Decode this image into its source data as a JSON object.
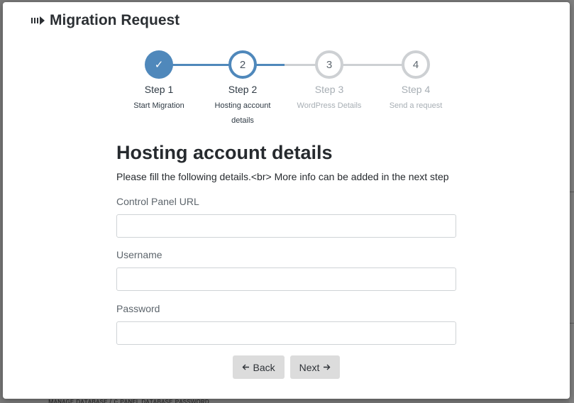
{
  "modal": {
    "title": "Migration Request"
  },
  "stepper": {
    "steps": [
      {
        "label": "Step 1",
        "sub": "Start Migration",
        "marker": "✓",
        "state": "done"
      },
      {
        "label": "Step 2",
        "sub": "Hosting account details",
        "marker": "2",
        "state": "active"
      },
      {
        "label": "Step 3",
        "sub": "WordPress Details",
        "marker": "3",
        "state": "pending"
      },
      {
        "label": "Step 4",
        "sub": "Send a request",
        "marker": "4",
        "state": "pending"
      }
    ],
    "colors": {
      "active": "#4f88bb",
      "inactive": "#cdd0d3"
    }
  },
  "form": {
    "title": "Hosting account details",
    "description": "Please fill the following details.<br> More info can be added in the next step",
    "fields": [
      {
        "label": "Control Panel URL",
        "value": "",
        "placeholder": ""
      },
      {
        "label": "Username",
        "value": "",
        "placeholder": ""
      },
      {
        "label": "Password",
        "value": "",
        "placeholder": ""
      }
    ]
  },
  "buttons": {
    "back_label": "Back",
    "next_label": "Next",
    "back_icon": "arrow-left-icon",
    "next_icon": "arrow-right-icon"
  },
  "background": {
    "partial_text": "ᴍᴀɴᴀɢᴇ ᴅᴀᴛᴀʙᴀsᴇ / ᴄ ᴘᴀɴᴇʟ ᴅᴀᴛᴀʙᴀsᴇ ᴘᴀssᴡᴏʀᴅ"
  }
}
